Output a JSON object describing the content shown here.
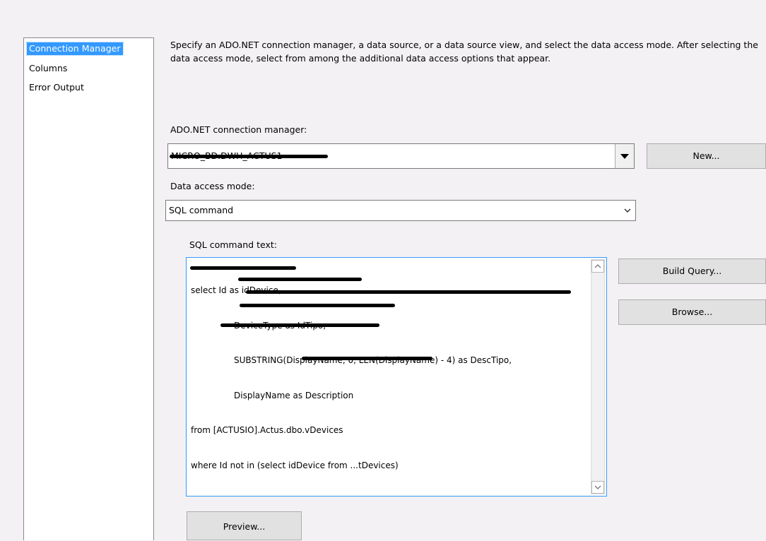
{
  "nav": {
    "items": [
      {
        "label": "Connection Manager",
        "selected": true
      },
      {
        "label": "Columns",
        "selected": false
      },
      {
        "label": "Error Output",
        "selected": false
      }
    ]
  },
  "description": "Specify an ADO.NET connection manager, a data source, or a data source view, and select the data access mode. After selecting the data access mode, select from among the additional data access options that appear.",
  "connection": {
    "label": "ADO.NET connection manager:",
    "value": "MICRO_BD.DWH_ACTUS1",
    "new_button": "New..."
  },
  "access_mode": {
    "label": "Data access mode:",
    "value": "SQL command"
  },
  "sql": {
    "label": "SQL command text:",
    "lines": [
      "select Id as idDevice,",
      "                DeviceType as IdTipo,",
      "                SUBSTRING(DisplayName, 0, LEN(DisplayName) - 4) as DescTipo,",
      "                DisplayName as Description",
      "from [ACTUSIO].Actus.dbo.vDevices",
      "where Id not in (select idDevice from ...tDevices)"
    ],
    "build_query_button": "Build Query...",
    "browse_button": "Browse..."
  },
  "preview_button": "Preview...",
  "icons": {
    "dropdown": "triangle-down-icon",
    "chevron": "chevron-down-icon",
    "scroll_up": "scroll-up-icon",
    "scroll_down": "scroll-down-icon"
  },
  "colors": {
    "selection": "#3399ff",
    "focus_border": "#3399ff",
    "background": "#f4f1f4"
  }
}
